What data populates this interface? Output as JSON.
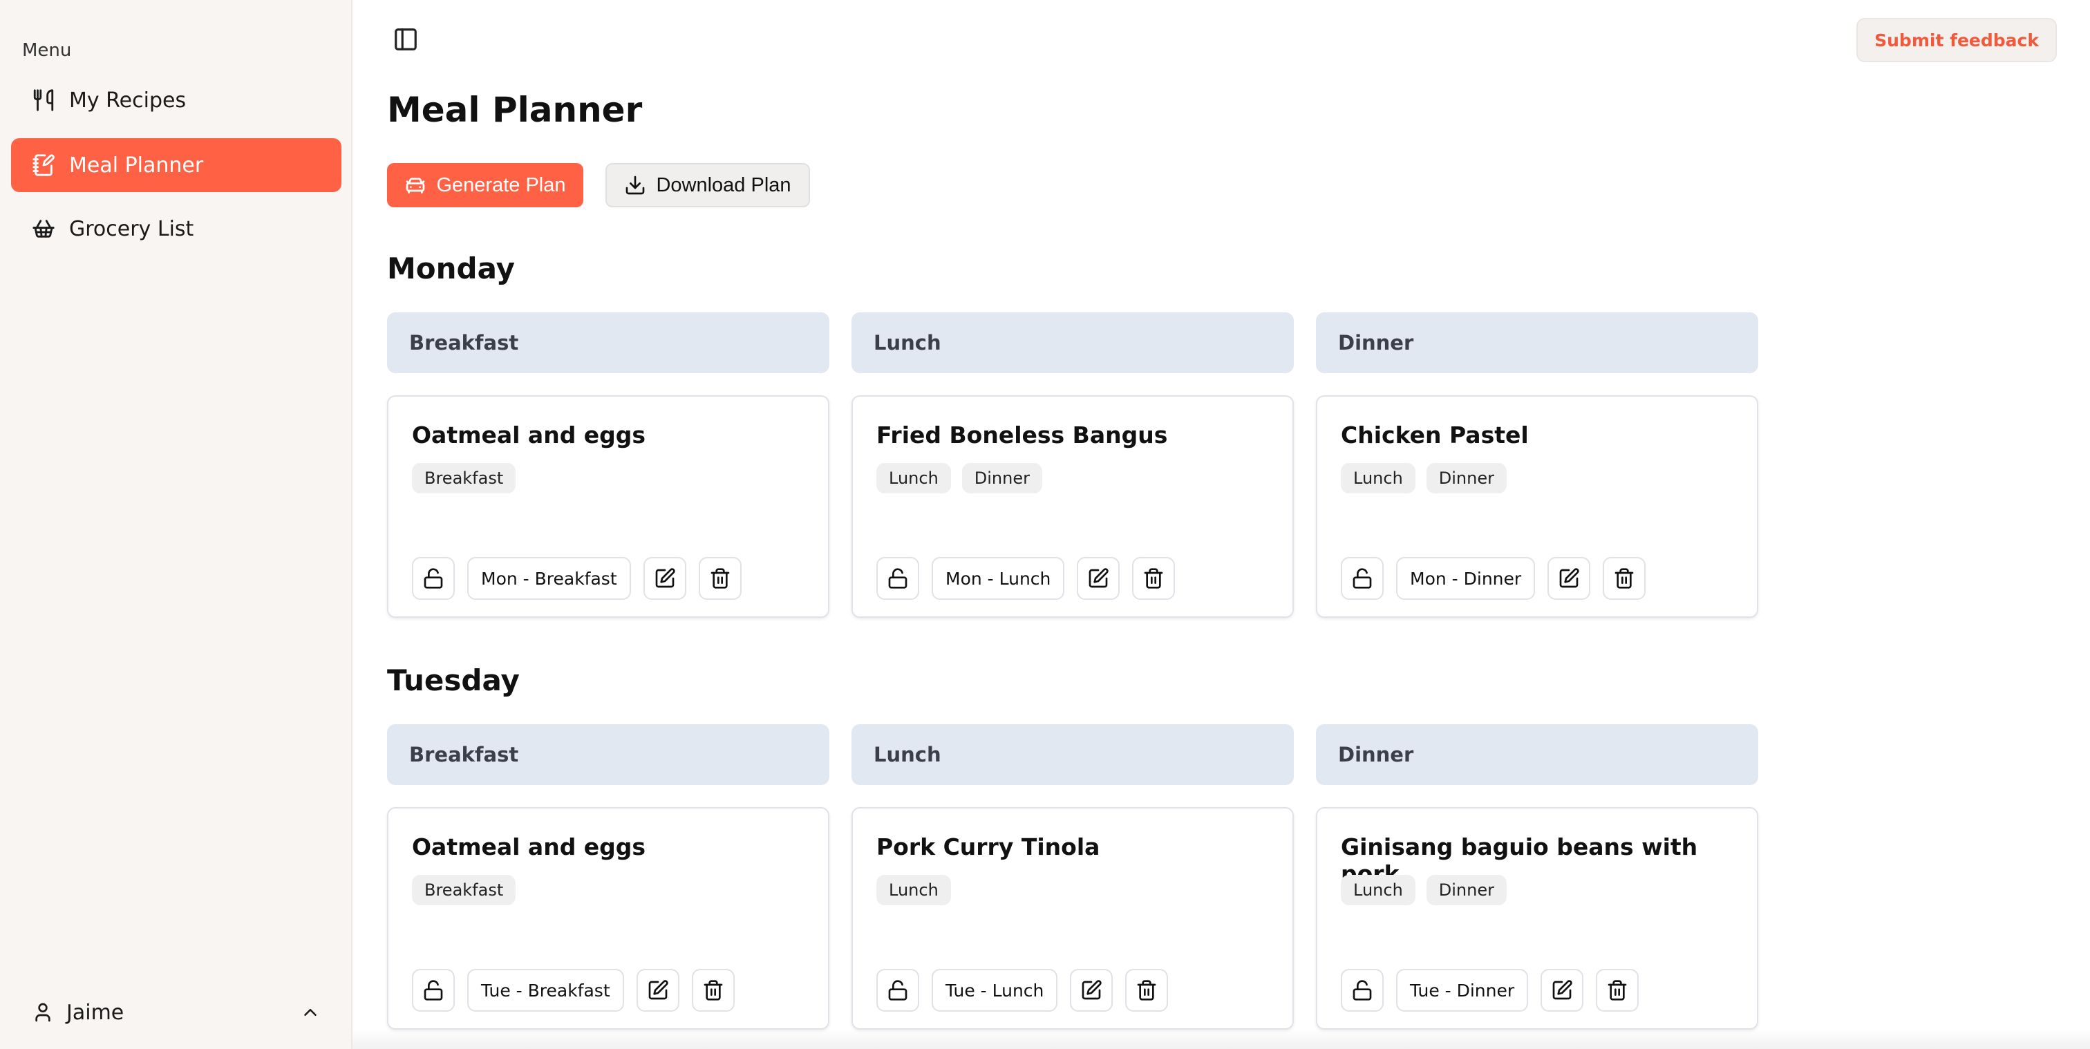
{
  "sidebar": {
    "menu_label": "Menu",
    "items": [
      {
        "label": "My Recipes",
        "icon": "utensils-icon",
        "active": false
      },
      {
        "label": "Meal Planner",
        "icon": "notebook-pen-icon",
        "active": true
      },
      {
        "label": "Grocery List",
        "icon": "basket-icon",
        "active": false
      }
    ],
    "user": {
      "name": "Jaime"
    }
  },
  "header": {
    "feedback_label": "Submit feedback"
  },
  "main": {
    "title": "Meal Planner",
    "generate_label": "Generate Plan",
    "download_label": "Download Plan",
    "days": [
      {
        "name": "Monday",
        "slots": [
          {
            "header": "Breakfast",
            "recipe": "Oatmeal and eggs",
            "tags": [
              "Breakfast"
            ],
            "slot_label": "Mon - Breakfast"
          },
          {
            "header": "Lunch",
            "recipe": "Fried Boneless Bangus",
            "tags": [
              "Lunch",
              "Dinner"
            ],
            "slot_label": "Mon - Lunch"
          },
          {
            "header": "Dinner",
            "recipe": "Chicken Pastel",
            "tags": [
              "Lunch",
              "Dinner"
            ],
            "slot_label": "Mon - Dinner"
          }
        ]
      },
      {
        "name": "Tuesday",
        "slots": [
          {
            "header": "Breakfast",
            "recipe": "Oatmeal and eggs",
            "tags": [
              "Breakfast"
            ],
            "slot_label": "Tue - Breakfast"
          },
          {
            "header": "Lunch",
            "recipe": "Pork Curry Tinola",
            "tags": [
              "Lunch"
            ],
            "slot_label": "Tue - Lunch"
          },
          {
            "header": "Dinner",
            "recipe": "Ginisang baguio beans with pork",
            "tags": [
              "Lunch",
              "Dinner"
            ],
            "slot_label": "Tue - Dinner"
          }
        ]
      }
    ]
  },
  "colors": {
    "accent": "#ff6144",
    "sidebar_bg": "#f8f5f2",
    "slot_header_bg": "#e2e8f1"
  }
}
